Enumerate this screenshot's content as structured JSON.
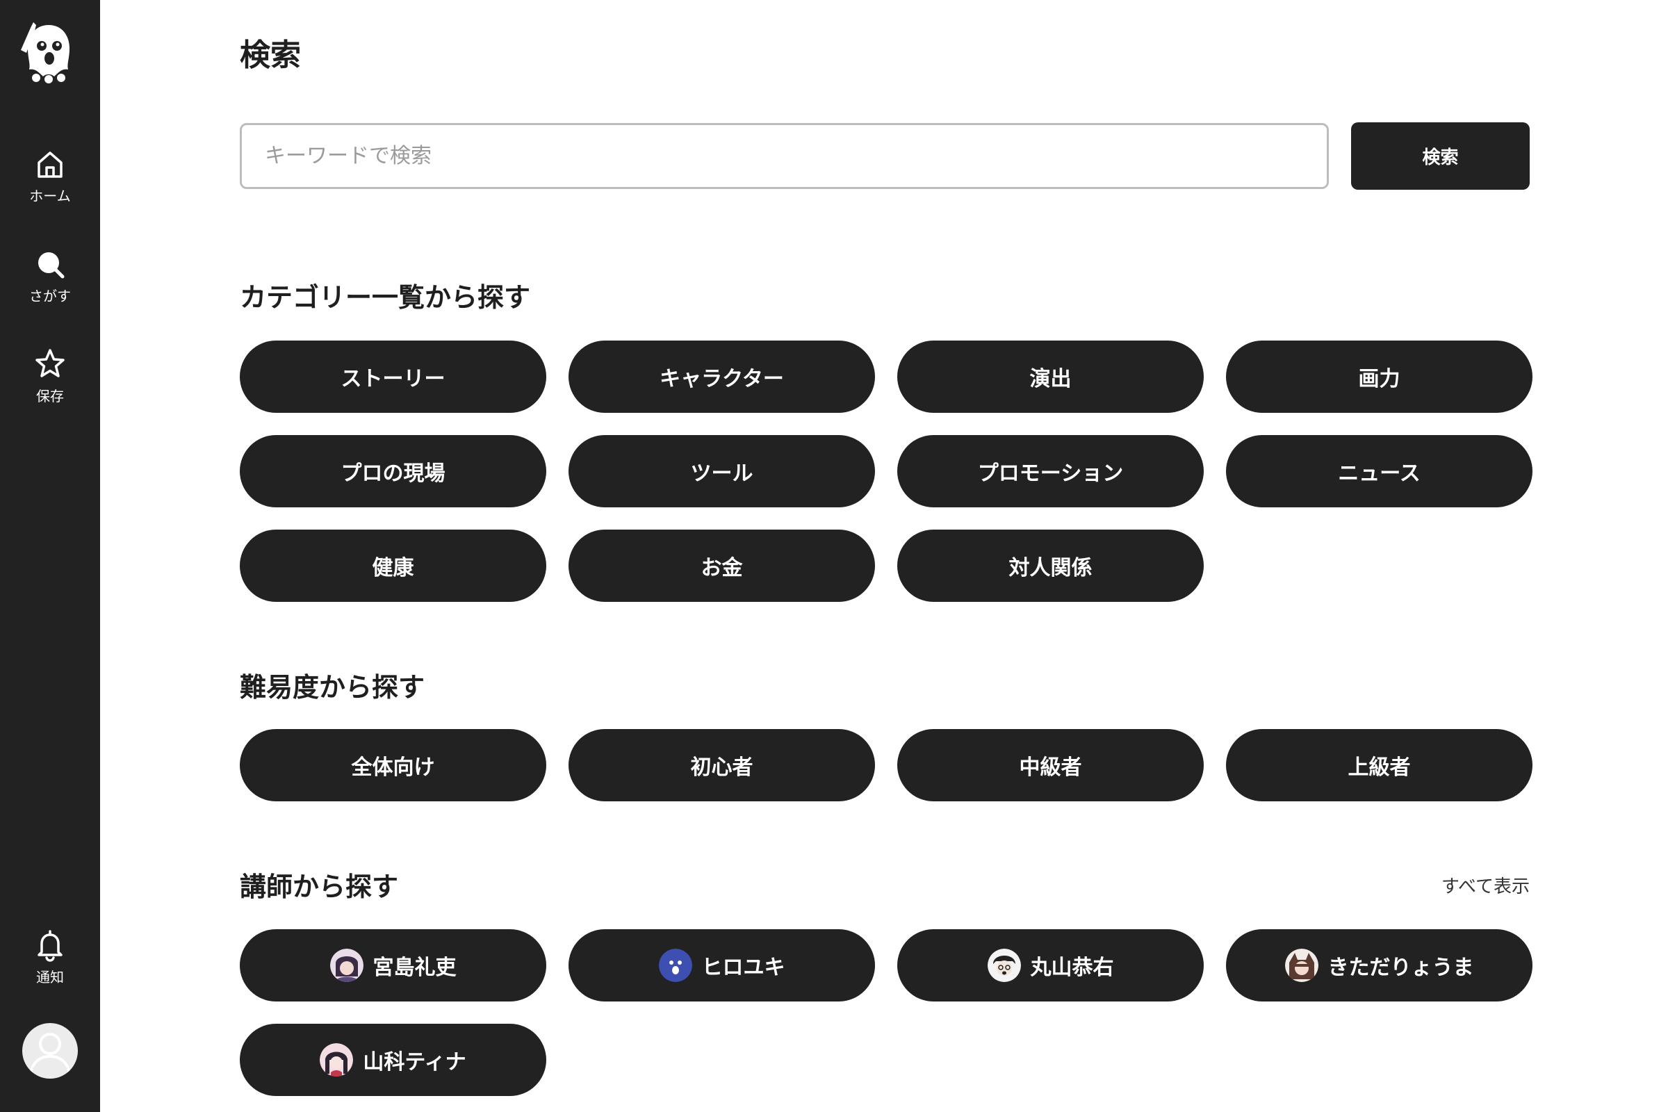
{
  "sidebar": {
    "logo_icon": "bird-mascot-logo-icon",
    "items": [
      {
        "label": "ホーム",
        "icon": "home-icon"
      },
      {
        "label": "さがす",
        "icon": "search-icon"
      },
      {
        "label": "保存",
        "icon": "star-icon"
      },
      {
        "label": "通知",
        "icon": "bell-icon"
      }
    ],
    "avatar_icon": "user-avatar-icon"
  },
  "main": {
    "title": "検索",
    "search": {
      "placeholder": "キーワードで検索",
      "value": "",
      "button_label": "検索"
    },
    "categories": {
      "title": "カテゴリー一覧から探す",
      "items": [
        "ストーリー",
        "キャラクター",
        "演出",
        "画力",
        "プロの現場",
        "ツール",
        "プロモーション",
        "ニュース",
        "健康",
        "お金",
        "対人関係"
      ]
    },
    "difficulty": {
      "title": "難易度から探す",
      "items": [
        "全体向け",
        "初心者",
        "中級者",
        "上級者"
      ]
    },
    "instructors": {
      "title": "講師から探す",
      "see_all": "すべて表示",
      "items": [
        "宮島礼吏",
        "ヒロユキ",
        "丸山恭右",
        "きただりょうま",
        "山科ティナ"
      ]
    }
  },
  "colors": {
    "sidebar_bg": "#222222",
    "pill_bg": "#222222",
    "pill_text": "#ffffff",
    "page_bg": "#ffffff",
    "input_border": "#bdbdbd"
  }
}
